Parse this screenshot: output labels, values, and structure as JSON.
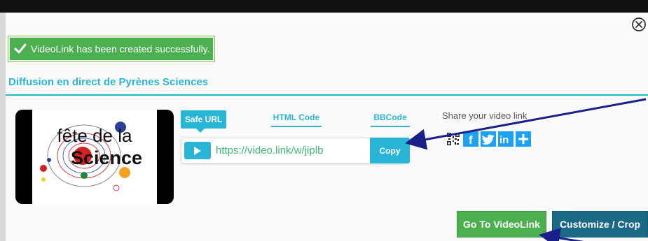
{
  "dialog": {
    "success_message": "VideoLink has been created successfully.",
    "title": "Diffusion en direct de Pyrènes Sciences"
  },
  "thumbnail": {
    "line1": "fête de la",
    "line2": "Science"
  },
  "tabs": {
    "safe_url": "Safe URL",
    "html_code": "HTML Code",
    "bbcode": "BBCode"
  },
  "link": {
    "url": "https://video.link/w/jiplb",
    "copy_label": "Copy"
  },
  "share": {
    "label": "Share your video link",
    "icons": [
      "qr-code-icon",
      "facebook-icon",
      "twitter-icon",
      "linkedin-icon",
      "plus-icon"
    ]
  },
  "actions": {
    "go_label": "Go To VideoLink",
    "customize_label": "Customize / Crop"
  },
  "colors": {
    "accent": "#29b6d6",
    "success": "#4caf50",
    "dark_button": "#1a6a86",
    "social_blue": "#1da1f2",
    "annotation_arrow": "#1b1f8a"
  }
}
